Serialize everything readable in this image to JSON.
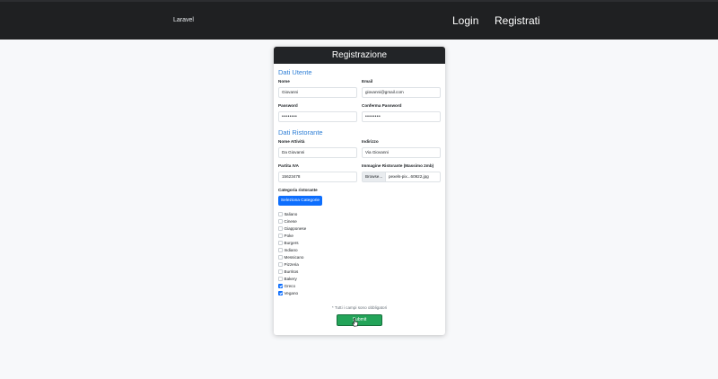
{
  "navbar": {
    "brand": "Laravel",
    "login": "Login",
    "register": "Registrati"
  },
  "card": {
    "title": "Registrazione",
    "user_section": "Dati Utente",
    "name_label": "Nome",
    "name_value": "Giovanni",
    "email_label": "Email",
    "email_value": "giovanni@gmail.com",
    "password_label": "Password",
    "password_value": "••••••••",
    "confirm_label": "Conferma Password",
    "confirm_value": "••••••••",
    "restaurant_section": "Dati Ristorante",
    "activity_label": "Nome Attività",
    "activity_value": "Da Giovanni",
    "address_label": "Indirizzo",
    "address_value": "Via Giovanni",
    "vat_label": "Partita IVA",
    "vat_value": "15623478",
    "image_label": "Immagine Ristorante (Massimo 2mb)",
    "image_browse": "Browse...",
    "image_file": "pexels-pix...60922.jpg",
    "category_label": "Categoria ristorante",
    "category_button": "Seleziona Categorie",
    "categories": [
      {
        "label": "Italiano",
        "checked": false
      },
      {
        "label": "Cinese",
        "checked": false
      },
      {
        "label": "Giapponese",
        "checked": false
      },
      {
        "label": "Poke",
        "checked": false
      },
      {
        "label": "Burgers",
        "checked": false
      },
      {
        "label": "Indiano",
        "checked": false
      },
      {
        "label": "Messicano",
        "checked": false
      },
      {
        "label": "Pizzeria",
        "checked": false
      },
      {
        "label": "Burritos",
        "checked": false
      },
      {
        "label": "Bakery",
        "checked": false
      },
      {
        "label": "Greco",
        "checked": true
      },
      {
        "label": "Vegano",
        "checked": true
      }
    ],
    "required_note": "* Tutti i campi sono obbligatori",
    "submit_label": "Submit"
  },
  "colors": {
    "navbar": "#1f2022",
    "accent": "#0d6efd",
    "section_title": "#2f7fd6",
    "submit": "#1f9d55"
  },
  "icons": {
    "cursor": "pointer-hand-icon",
    "checkbox": "checkbox-icon"
  }
}
